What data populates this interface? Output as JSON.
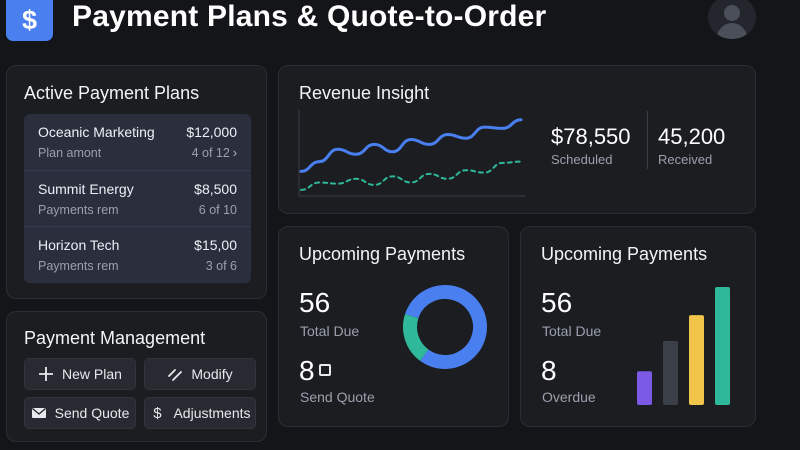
{
  "header": {
    "title": "Payment Plans & Quote-to-Order",
    "logo_symbol": "$",
    "logo_icon": "dollar-icon",
    "avatar_icon": "user-avatar-icon"
  },
  "active_plans": {
    "title": "Active Payment Plans",
    "plans": [
      {
        "name": "Oceanic Marketing",
        "amount": "$12,000",
        "sub_label": "Plan amont",
        "progress": "4 of 12"
      },
      {
        "name": "Summit Energy",
        "amount": "$8,500",
        "sub_label": "Payments rem",
        "progress": "6 of 10"
      },
      {
        "name": "Horizon Tech",
        "amount": "$15,00",
        "sub_label": "Payments rem",
        "progress": "3 of 6"
      }
    ]
  },
  "payment_management": {
    "title": "Payment Management",
    "buttons": {
      "new_plan": "New Plan",
      "modify": "Modify",
      "send_quote": "Send Quote",
      "adjustments": "Adjustments"
    }
  },
  "revenue_insight": {
    "title": "Revenue Insight",
    "scheduled_value": "$78,550",
    "scheduled_label": "Scheduled",
    "received_value": "45,200",
    "received_label": "Received"
  },
  "upcoming_left": {
    "title": "Upcoming Payments",
    "total_value": "56",
    "total_label": "Total Due",
    "quote_value": "8",
    "quote_label": "Send Quote",
    "donut_fraction": 0.8
  },
  "upcoming_right": {
    "title": "Upcoming Payments",
    "total_value": "56",
    "total_label": "Total Due",
    "overdue_value": "8",
    "overdue_label": "Overdue"
  },
  "colors": {
    "accent_blue": "#4a7ff0",
    "teal": "#2fb89a",
    "yellow": "#f1c44a",
    "purple": "#7b5ae6",
    "gray_bar": "#3a3f48"
  },
  "chart_data": [
    {
      "type": "line",
      "series": [
        {
          "values": [
            20,
            28,
            38,
            34,
            42,
            36,
            46,
            42,
            50,
            47,
            56,
            55,
            62
          ]
        },
        {
          "values": [
            5,
            11,
            10,
            14,
            9,
            16,
            11,
            18,
            14,
            21,
            19,
            27,
            28
          ]
        }
      ]
    },
    {
      "type": "pie",
      "values": [
        0.8,
        0.2
      ]
    },
    {
      "type": "bar",
      "values": [
        30,
        57,
        80,
        105
      ]
    }
  ]
}
